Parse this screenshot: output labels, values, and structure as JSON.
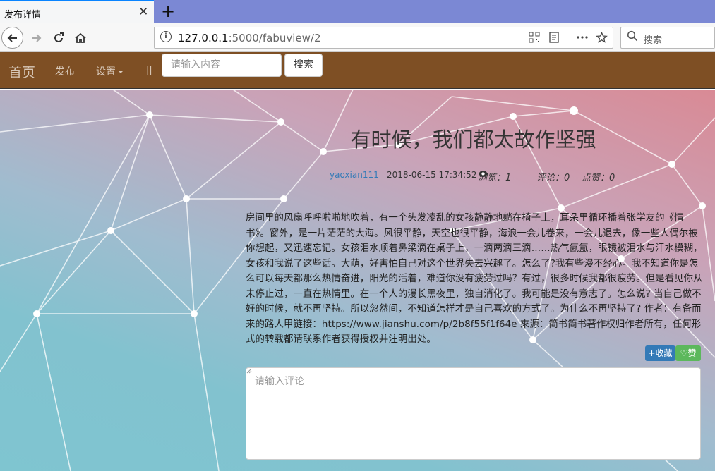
{
  "browser": {
    "tab_title": "发布详情",
    "close_glyph": "✕",
    "new_tab_glyph": "+",
    "url_host": "127.0.0.1",
    "url_path": ":5000/fabuview/2",
    "search_placeholder": "搜索",
    "icons": [
      "back-icon",
      "forward-icon",
      "reload-icon",
      "home-icon",
      "info-icon",
      "qr-code-icon",
      "reader-icon",
      "more-icon",
      "bookmark-star-icon",
      "search-icon"
    ]
  },
  "site_nav": {
    "brand": "首页",
    "links": [
      "发布",
      "设置"
    ],
    "separator": "||",
    "search_placeholder": "请输入内容",
    "search_button": "搜索"
  },
  "post": {
    "title": "有时候，我们都太故作坚强",
    "author": "yaoxian111",
    "date": "2018-06-15 17:34:52",
    "views": "浏览：1",
    "comments": "评论：0",
    "likes": "点赞：0",
    "body": "房间里的风扇呼呼啦啦地吹着，有一个头发凌乱的女孩静静地躺在椅子上，耳朵里循环播着张学友的《情书》。窗外，是一片茫茫的大海。风很平静，天空也很平静，海浪一会儿卷来，一会儿退去，像一些人偶尔被你想起，又迅速忘记。女孩泪水顺着鼻梁滴在桌子上，一滴两滴三滴……热气氤氲，眼镜被泪水与汗水模糊，女孩和我说了这些话。大萌，好害怕自己对这个世界失去兴趣了。怎么了?我有些漫不经心。我不知道你是怎么可以每天都那么热情奋进，阳光的活着，难道你没有疲劳过吗？有过，很多时候我都很疲劳。但是看见你从未停止过，一直在热情里。在一个人的漫长黑夜里，独自消化了。我可能是没有意志了。怎么说? 当自己做不好的时候，就不再坚持。所以忽然间，不知道怎样才是自己喜欢的方式了。为什么不再坚持了? 作者：有备而来的路人甲链接：https://www.jianshu.com/p/2b8f55f1f64e 來源：简书简书著作权归作者所有，任何形式的转载都请联系作者获得授权并注明出处。",
    "favorite_button": "+收藏",
    "like_button": "♡赞",
    "comment_placeholder": "请输入评论"
  },
  "colors": {
    "header_bg": "#7e4f24",
    "tab_strip": "#7b88d4",
    "favorite_btn": "#337ab7",
    "like_btn": "#5cb85c"
  }
}
